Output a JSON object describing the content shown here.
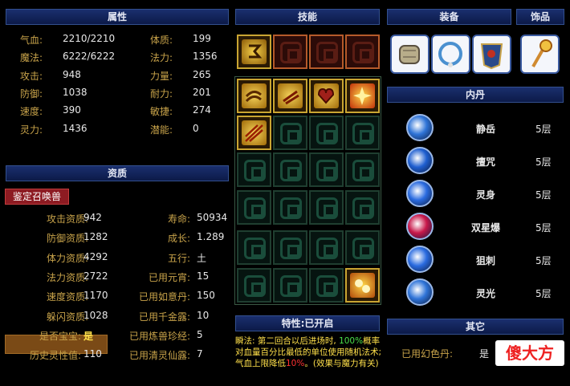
{
  "attributes": {
    "header": "属性",
    "rows": [
      {
        "l1": "气血:",
        "v1": "2210/2210",
        "l2": "体质:",
        "v2": "199"
      },
      {
        "l1": "魔法:",
        "v1": "6222/6222",
        "l2": "法力:",
        "v2": "1356"
      },
      {
        "l1": "攻击:",
        "v1": "948",
        "l2": "力量:",
        "v2": "265"
      },
      {
        "l1": "防御:",
        "v1": "1038",
        "l2": "耐力:",
        "v2": "201"
      },
      {
        "l1": "速度:",
        "v1": "390",
        "l2": "敏捷:",
        "v2": "274"
      },
      {
        "l1": "灵力:",
        "v1": "1436",
        "l2": "潜能:",
        "v2": "0"
      }
    ]
  },
  "aptitude": {
    "header": "资质",
    "identify_button": "鉴定召唤兽",
    "rows": [
      {
        "l1": "攻击资质:",
        "v1": "942",
        "l2": "寿命:",
        "v2": "50934"
      },
      {
        "l1": "防御资质:",
        "v1": "1282",
        "l2": "成长:",
        "v2": "1.289"
      },
      {
        "l1": "体力资质:",
        "v1": "4292",
        "l2": "五行:",
        "v2": "土"
      },
      {
        "l1": "法力资质:",
        "v1": "2722",
        "l2": "已用元宵:",
        "v2": "15"
      },
      {
        "l1": "速度资质:",
        "v1": "1170",
        "l2": "已用如意丹:",
        "v2": "150"
      },
      {
        "l1": "躲闪资质:",
        "v1": "1028",
        "l2": "已用千金露:",
        "v2": "10"
      },
      {
        "l1": "是否宝宝:",
        "v1": "是",
        "l2": "已用炼兽珍经:",
        "v2": "5"
      },
      {
        "l1": "历史灵性值:",
        "v1": "110",
        "l2": "已用清灵仙露:",
        "v2": "7"
      }
    ]
  },
  "skills": {
    "header": "技能",
    "trait_header": "特性:已开启",
    "trait_text_1": "瞬法: 第二回合以后进场时, ",
    "trait_pct_1": "100%",
    "trait_text_2": "概率对血量百分比最低的单位使用随机法术; 气血上限降低",
    "trait_pct_2": "10%",
    "trait_text_3": "。(效果与魔力有关)"
  },
  "equipment": {
    "header": "装备",
    "accessory_header": "饰品"
  },
  "neidan": {
    "header": "内丹",
    "items": [
      {
        "name": "静岳",
        "level": "5层",
        "color": "#2f74d8"
      },
      {
        "name": "擅咒",
        "level": "5层",
        "color": "#1f5fd0"
      },
      {
        "name": "灵身",
        "level": "5层",
        "color": "#2a6be0"
      },
      {
        "name": "双星爆",
        "level": "5层",
        "color": "#c8184a"
      },
      {
        "name": "狙刺",
        "level": "5层",
        "color": "#2a6be0"
      },
      {
        "name": "灵光",
        "level": "5层",
        "color": "#2f74d8"
      }
    ]
  },
  "other": {
    "header": "其它",
    "label": "已用幻色丹:",
    "value": "是"
  },
  "watermark": "傻大方"
}
